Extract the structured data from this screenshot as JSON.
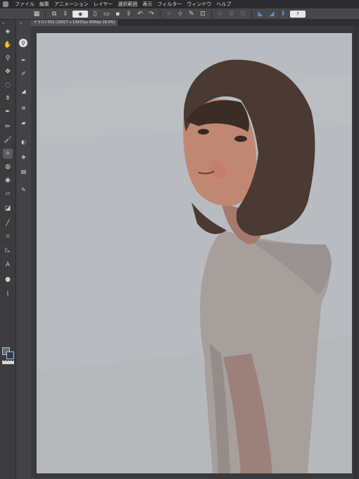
{
  "menubar": {
    "items": [
      "ファイル",
      "編集",
      "アニメーション",
      "レイヤー",
      "選択範囲",
      "表示",
      "フィルター",
      "ウィンドウ",
      "ヘルプ"
    ]
  },
  "toolbar": {
    "buttons": [
      {
        "name": "grid-icon",
        "glyph": "▦"
      },
      {
        "name": "navigator-icon",
        "glyph": "⧉"
      },
      {
        "name": "arrows-updown-icon",
        "glyph": "⇳"
      },
      {
        "name": "eye-badge-icon",
        "glyph": "◉"
      },
      {
        "name": "new-file-icon",
        "glyph": "▯"
      },
      {
        "name": "open-file-icon",
        "glyph": "▭"
      },
      {
        "name": "save-icon",
        "glyph": "▪"
      },
      {
        "name": "arrows-updown-icon-2",
        "glyph": "⇳"
      },
      {
        "name": "undo-icon",
        "glyph": "↶"
      },
      {
        "name": "redo-icon",
        "glyph": "↷"
      },
      {
        "name": "select-dots-icon",
        "glyph": "⁘"
      },
      {
        "name": "transform-icon",
        "glyph": "⊹"
      },
      {
        "name": "brush-icon",
        "glyph": "✎"
      },
      {
        "name": "crop-icon",
        "glyph": "⊡"
      },
      {
        "name": "dim-icon-1",
        "glyph": "⊘"
      },
      {
        "name": "dim-icon-2",
        "glyph": "⊞"
      },
      {
        "name": "dim-icon-3",
        "glyph": "⊟"
      },
      {
        "name": "ruler-blue-icon",
        "glyph": "◣"
      },
      {
        "name": "ruler-blue-icon-2",
        "glyph": "◢"
      },
      {
        "name": "pin-blue-icon",
        "glyph": "⬇"
      },
      {
        "name": "help-icon",
        "glyph": "?"
      }
    ]
  },
  "tab": {
    "title": "イラスト552 (10027 x 13937px 600dpi 18.0%)"
  },
  "tools": [
    {
      "name": "brush-tip-icon",
      "glyph": "◈"
    },
    {
      "name": "hand-icon",
      "glyph": "✋"
    },
    {
      "name": "zoom-icon",
      "glyph": "⚲"
    },
    {
      "name": "move-icon",
      "glyph": "✥"
    },
    {
      "name": "lasso-icon",
      "glyph": "◌"
    },
    {
      "name": "dropper-icon",
      "glyph": "⚱"
    },
    {
      "name": "pen-icon",
      "glyph": "✒"
    },
    {
      "name": "pencil-icon",
      "glyph": "✏"
    },
    {
      "name": "brush-tool-icon",
      "glyph": "🖌"
    },
    {
      "name": "airbrush-icon",
      "glyph": "⟡"
    },
    {
      "name": "blend-icon",
      "glyph": "◍"
    },
    {
      "name": "fill-icon",
      "glyph": "◉"
    },
    {
      "name": "eraser-icon",
      "glyph": "▱"
    },
    {
      "name": "gradient-icon",
      "glyph": "◪"
    },
    {
      "name": "line-icon",
      "glyph": "╱"
    },
    {
      "name": "frame-icon",
      "glyph": "⌗"
    },
    {
      "name": "ruler-icon",
      "glyph": "◺"
    },
    {
      "name": "text-icon",
      "glyph": "A"
    },
    {
      "name": "balloon-icon",
      "glyph": "●"
    },
    {
      "name": "correct-line-icon",
      "glyph": "⌇"
    }
  ],
  "subtools": [
    {
      "name": "pen-settings-icon",
      "glyph": "✒"
    },
    {
      "name": "brush-settings-icon",
      "glyph": "✐"
    },
    {
      "name": "brush-size-icon",
      "glyph": "◢"
    },
    {
      "name": "layers-icon",
      "glyph": "≋"
    },
    {
      "name": "folder-icon",
      "glyph": "▰"
    },
    {
      "name": "color-wheel-icon",
      "glyph": "◐"
    },
    {
      "name": "color-set-icon",
      "glyph": "❖"
    },
    {
      "name": "color-slider-icon",
      "glyph": "▤"
    },
    {
      "name": "sub-brush-icon",
      "glyph": "✎"
    }
  ]
}
